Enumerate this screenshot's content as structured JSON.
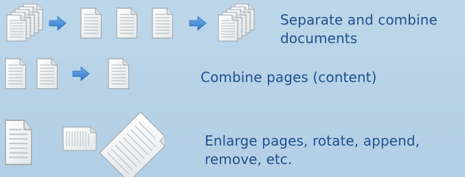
{
  "rows": [
    {
      "id": "separate-combine",
      "caption_lines": [
        "Separate and combine",
        "documents"
      ]
    },
    {
      "id": "combine-pages",
      "caption_lines": [
        "Combine pages (content)"
      ]
    },
    {
      "id": "enlarge-rotate",
      "caption_lines": [
        "Enlarge pages, rotate, append,",
        "remove, etc."
      ]
    }
  ],
  "icons": [
    "document-stack-icon",
    "document-icon",
    "arrow-right-icon",
    "rotated-document-icon",
    "landscape-document-icon"
  ],
  "colors": {
    "background": "#b8d4e8",
    "caption_text": "#1f4f8e",
    "arrow": "#4a8fd6",
    "page_fill": "#f4f6f6",
    "page_lines": "#c9cdd0"
  }
}
